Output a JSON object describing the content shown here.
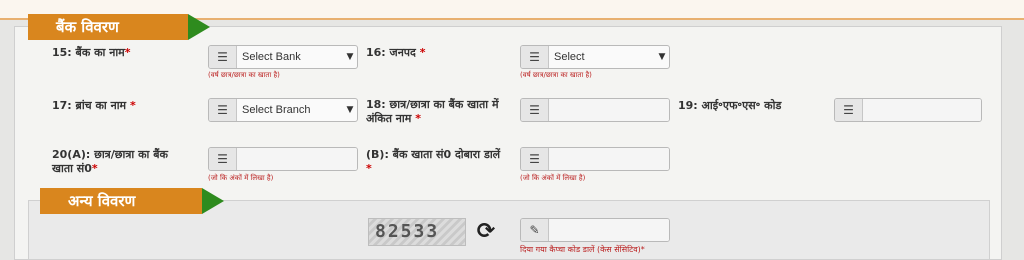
{
  "bank_section": {
    "title": "बैंक विवरण",
    "fields": {
      "bank_name": {
        "label": "15: बैंक का नाम",
        "required": "*",
        "value": "Select Bank",
        "hint": "(वर्ष छात्र/छात्रा का खाता है)"
      },
      "district": {
        "label": "16: जनपद",
        "required": "*",
        "value": "Select",
        "hint": "(वर्ष छात्र/छात्रा का खाता है)"
      },
      "branch_name": {
        "label": "17: ब्रांच का नाम",
        "required": "*",
        "value": "Select Branch"
      },
      "account_holder": {
        "label": "18: छात्र/छात्रा का बैंक खाता में अंकित नाम",
        "required": "*",
        "value": ""
      },
      "ifsc": {
        "label": "19: आई॰एफ॰एस॰ कोड",
        "value": ""
      },
      "account_no": {
        "label": "20(A): छात्र/छात्रा का बैंक खाता सं0",
        "required": "*",
        "value": "",
        "hint": "(जो कि अंकों में लिखा है)"
      },
      "account_no_confirm": {
        "label": "(B): बैंक खाता सं0 दोबारा डालें",
        "required": "*",
        "value": "",
        "hint": "(जो कि अंकों में लिखा है)"
      }
    }
  },
  "other_section": {
    "title": "अन्य विवरण",
    "captcha": {
      "code": "82533",
      "value": "",
      "hint": "दिया गया कैप्चा कोड डालें (केस सेंसिटिव)*"
    }
  },
  "icons": {
    "field_icon": "list-icon",
    "captcha_field_icon": "edit-icon",
    "refresh_icon": "refresh-icon"
  },
  "colors": {
    "tab_orange": "#d9861e",
    "tab_arrow_green": "#2e8b1e",
    "hint_red": "#b22222"
  }
}
